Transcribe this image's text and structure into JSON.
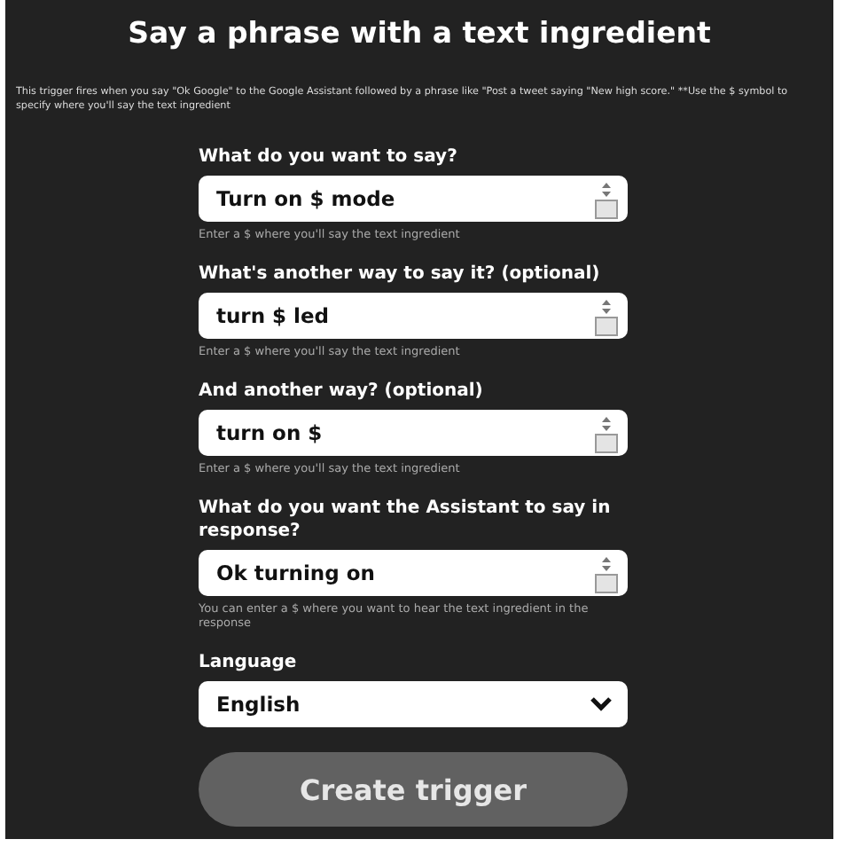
{
  "title": "Say a phrase with a text ingredient",
  "description": "This trigger fires when you say \"Ok Google\" to the Google Assistant followed by a phrase like \"Post a tweet saying \"New high score.\" **Use the $ symbol to specify where you'll say the text ingredient",
  "fields": [
    {
      "kind": "textarea",
      "label": "What do you want to say?",
      "value": "Turn on $ mode",
      "hint": "Enter a $ where you'll say the text ingredient"
    },
    {
      "kind": "textarea",
      "label": "What's another way to say it? (optional)",
      "value": "turn $ led",
      "hint": "Enter a $ where you'll say the text ingredient"
    },
    {
      "kind": "textarea",
      "label": "And another way? (optional)",
      "value": "turn on $",
      "hint": "Enter a $ where you'll say the text ingredient"
    },
    {
      "kind": "textarea",
      "label": "What do you want the Assistant to say in response?",
      "value": "Ok turning on",
      "hint": "You can enter a $ where you want to hear the text ingredient in the response"
    },
    {
      "kind": "select",
      "label": "Language",
      "value": "English"
    }
  ],
  "button": {
    "label": "Create trigger",
    "disabled": true
  }
}
